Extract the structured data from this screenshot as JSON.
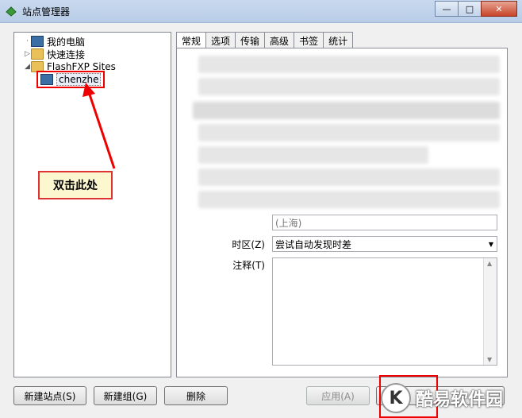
{
  "window": {
    "title": "站点管理器",
    "minimize": "—",
    "maximize": "□",
    "close": "✕"
  },
  "tree": {
    "items": [
      {
        "label": "我的电脑",
        "icon": "computer-icon"
      },
      {
        "label": "快速连接",
        "icon": "folder-icon"
      },
      {
        "label": "FlashFXP Sites",
        "icon": "folder-icon"
      },
      {
        "label": "chenzhe",
        "icon": "site-icon"
      }
    ]
  },
  "annotation": {
    "callout": "双击此处"
  },
  "tabs": [
    "常规",
    "选项",
    "传输",
    "高级",
    "书签",
    "统计"
  ],
  "form": {
    "timezone_label": "时区(Z)",
    "timezone_value": "尝试自动发现时差",
    "notes_label": "注释(T)",
    "partial_value": "(上海)"
  },
  "buttons": {
    "new_site": "新建站点(S)",
    "new_group": "新建组(G)",
    "delete": "删除",
    "apply": "应用(A)"
  },
  "watermark": {
    "logo": "K",
    "text": "酷易软件园"
  },
  "colors": {
    "annotation_red": "#e00000",
    "callout_bg": "#fdf7d0"
  }
}
